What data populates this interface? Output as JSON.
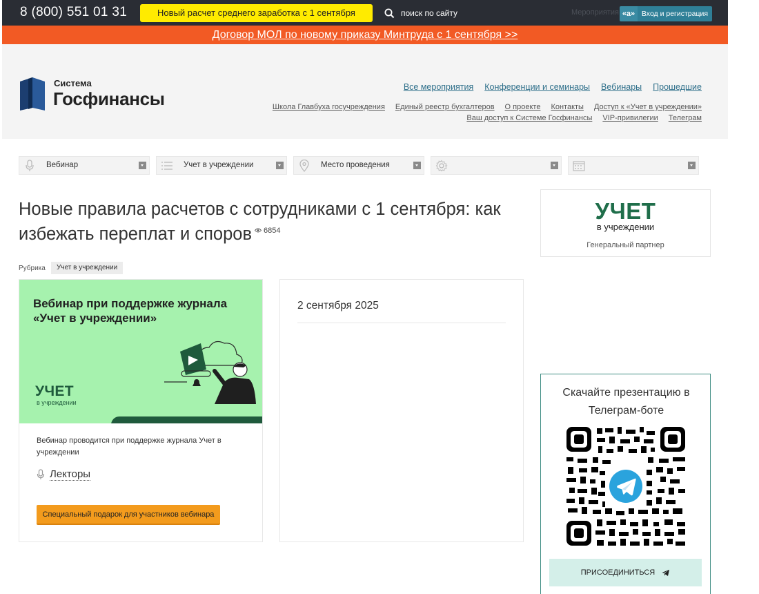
{
  "topbar": {
    "phone": "8 (800) 551 01 31",
    "promo": "Новый расчет среднего заработка с 1 сентября",
    "search_placeholder": "поиск по сайту",
    "events_faded": "Мероприятия",
    "login_badge": "«a»",
    "login_label": "Вход и регистрация"
  },
  "banner": {
    "text": "Договор МОЛ по новому приказу Минтруда с 1 сентября >>"
  },
  "logo": {
    "small": "Система",
    "big": "Госфинансы"
  },
  "nav": {
    "primary": [
      "Все мероприятия",
      "Конференции и семинары",
      "Вебинары",
      "Прошедшие"
    ],
    "secondary_row1": [
      "Школа Главбуха госучреждения",
      "Единый реестр бухгалтеров",
      "О проекте",
      "Контакты",
      "Доступ к «Учет в учреждении»"
    ],
    "secondary_row2": [
      "Ваш доступ к Системе Госфинансы",
      "VIP-привилегии",
      "Телеграм"
    ]
  },
  "filters": {
    "type": "Вебинар",
    "topic": "Учет в учреждении",
    "place": "Место проведения",
    "settings": "",
    "date": ""
  },
  "article": {
    "title": "Новые правила расчетов с сотрудниками с 1 сентября: как избежать переплат и споров",
    "views": "6854",
    "rubric_label": "Рубрика",
    "rubric_tag": "Учет в учреждении"
  },
  "event_card": {
    "banner_text": "Вебинар при поддержке журнала «Учет в учреждении»",
    "banner_logo_big": "УЧЕТ",
    "banner_logo_small": "в учреждении",
    "description": "Вебинар проводится при поддержке журнала Учет в учреждении",
    "lectors": "Лекторы",
    "gift_button": "Специальный подарок для участников вебинара"
  },
  "date_card": {
    "date": "2 сентября 2025"
  },
  "partner": {
    "logo_big": "УЧЕТ",
    "logo_small": "в учреждении",
    "label": "Генеральный партнер"
  },
  "telegram": {
    "title": "Скачайте презентацию в Телеграм-боте",
    "button": "ПРИСОЕДИНИТЬСЯ"
  },
  "colors": {
    "topbar": "#2a2d34",
    "promo_yellow": "#ffeb00",
    "banner_orange": "#f25a24",
    "link": "#2e6f8a",
    "event_green": "#a6f2ae",
    "brand_green": "#1f6e4a",
    "gift_orange": "#f39b1d",
    "tg_border": "#3f8d83",
    "tg_button": "#d4efe9"
  }
}
